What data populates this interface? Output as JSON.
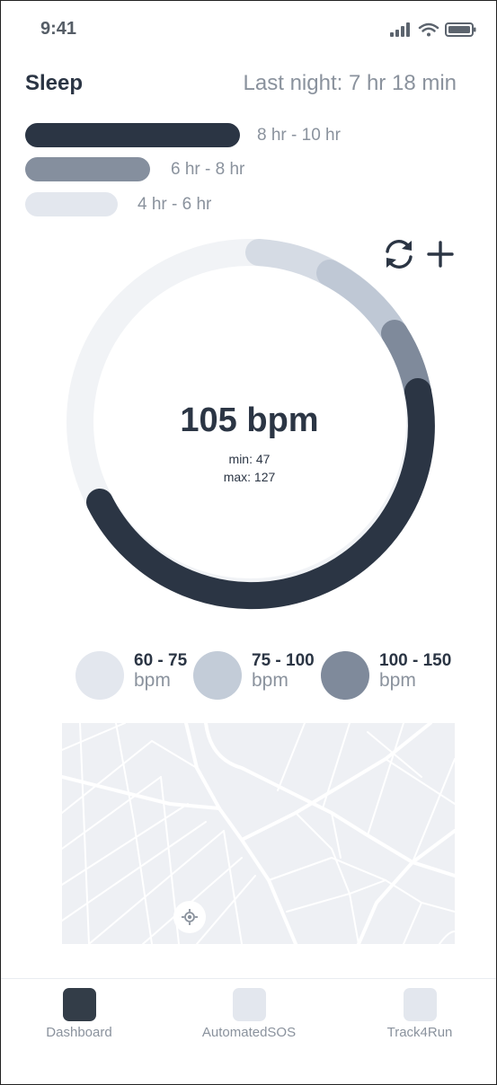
{
  "status_bar": {
    "time": "9:41",
    "icons": [
      "signal-icon",
      "wifi-icon",
      "battery-icon"
    ]
  },
  "header": {
    "title": "Sleep",
    "last_night": "Last night: 7 hr 18 min"
  },
  "sleep_bars": [
    {
      "label": "8 hr - 10 hr",
      "color": "#2b3544"
    },
    {
      "label": "6 hr - 8 hr",
      "color": "#858f9e"
    },
    {
      "label": "4 hr - 6 hr",
      "color": "#e3e7ee"
    }
  ],
  "heart": {
    "value": "105 bpm",
    "min": "min: 47",
    "max": "max: 127",
    "actions": [
      "refresh-icon",
      "add-icon"
    ]
  },
  "zones": [
    {
      "range": "60 - 75",
      "unit": "bpm",
      "color": "#e3e7ee"
    },
    {
      "range": "75 - 100",
      "unit": "bpm",
      "color": "#c3ccd8"
    },
    {
      "range": "100 - 150",
      "unit": "bpm",
      "color": "#7f8a9b"
    }
  ],
  "map": {
    "locate_icon": "locate-icon"
  },
  "nav": {
    "items": [
      {
        "label": "Dashboard",
        "active": true
      },
      {
        "label": "AutomatedSOS",
        "active": false
      },
      {
        "label": "Track4Run",
        "active": false
      }
    ]
  },
  "colors": {
    "dark": "#2b3544",
    "muted": "#8a929d",
    "ring_track": "#f1f3f6"
  }
}
